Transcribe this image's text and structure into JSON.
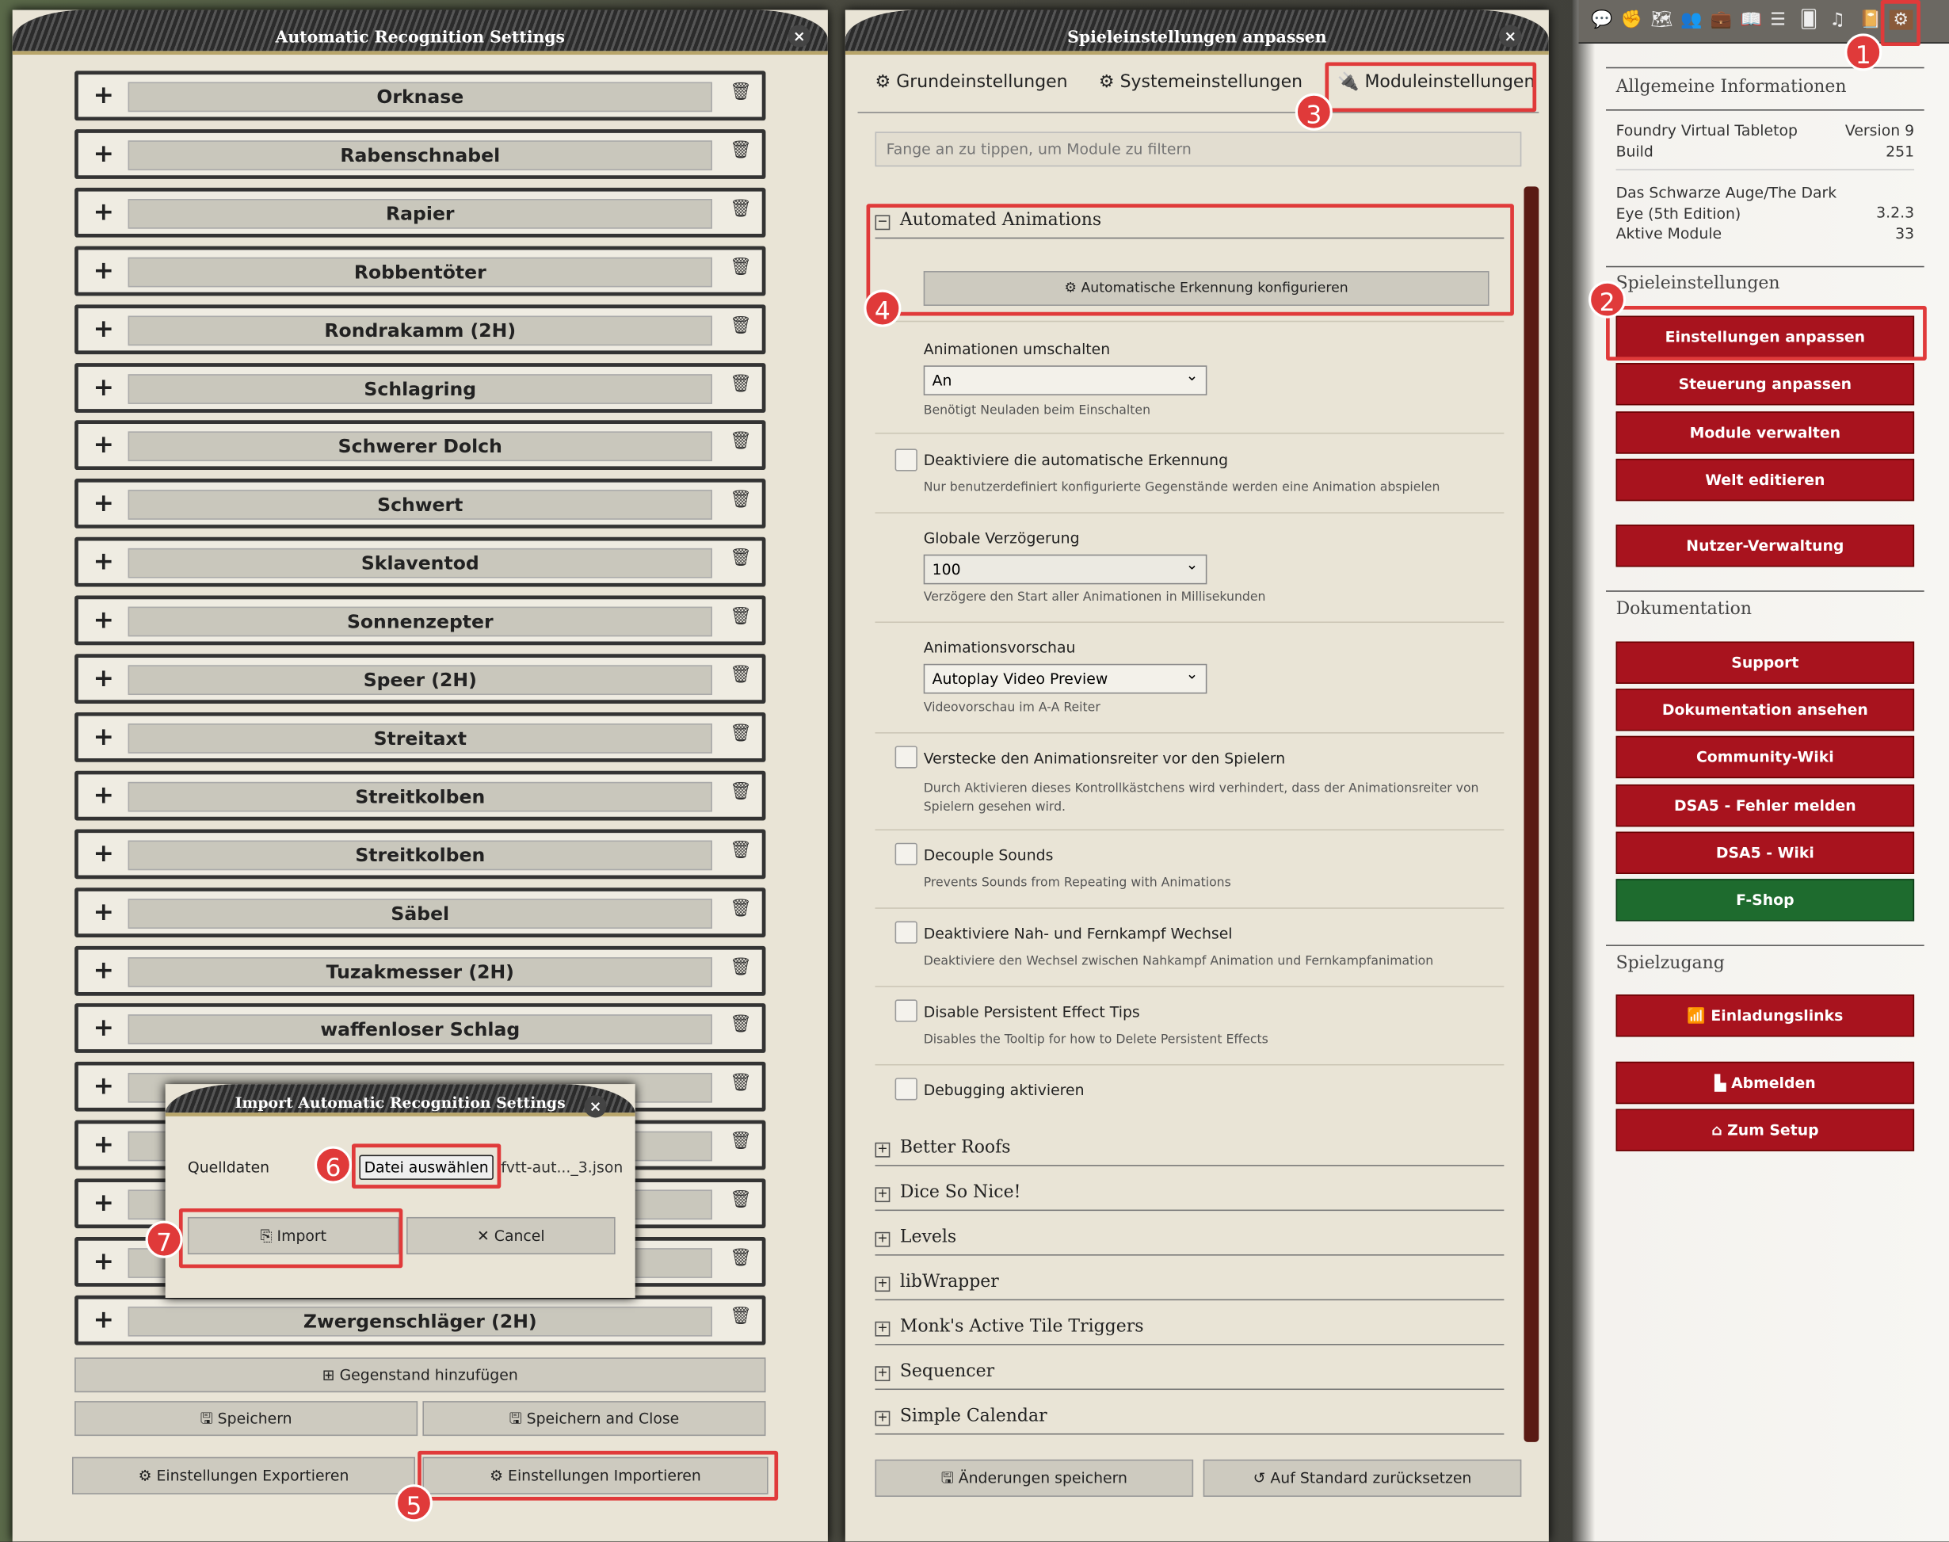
{
  "left_window": {
    "title": "Automatic Recognition Settings",
    "close_label": "×",
    "items": [
      "Orknase",
      "Rabenschnabel",
      "Rapier",
      "Robbentöter",
      "Rondrakamm (2H)",
      "Schlagring",
      "Schwerer Dolch",
      "Schwert",
      "Sklaventod",
      "Sonnenzepter",
      "Speer (2H)",
      "Streitaxt",
      "Streitkolben",
      "Streitkolben",
      "Säbel",
      "Tuzakmesser (2H)",
      "waffenloser Schlag",
      "",
      "",
      "",
      "",
      "Zwergenschläger (2H)"
    ],
    "add_item": "Gegenstand hinzufügen",
    "save": "Speichern",
    "save_close": "Speichern and Close",
    "export": "Einstellungen Exportieren",
    "import": "Einstellungen Importieren"
  },
  "import_dialog": {
    "title": "Import Automatic Recognition Settings",
    "source_label": "Quelldaten",
    "file_button": "Datei auswählen",
    "file_name": "fvtt-aut..._3.json",
    "import": "Import",
    "cancel": "Cancel"
  },
  "settings_window": {
    "title": "Spieleinstellungen anpassen",
    "tabs": [
      "Grundeinstellungen",
      "Systemeinstellungen",
      "Moduleinstellungen"
    ],
    "active_tab": "Moduleinstellungen",
    "filter_placeholder": "Fange an zu tippen, um Module zu filtern",
    "module_open": "Automated Animations",
    "config_button": "Automatische Erkennung konfigurieren",
    "anim_toggle_label": "Animationen umschalten",
    "anim_toggle_value": "An",
    "anim_toggle_hint": "Benötigt Neuladen beim Einschalten",
    "disable_auto_label": "Deaktiviere die automatische Erkennung",
    "disable_auto_hint": "Nur benutzerdefiniert konfigurierte Gegenstände werden eine Animation abspielen",
    "delay_label": "Globale Verzögerung",
    "delay_value": "100",
    "delay_hint": "Verzögere den Start aller Animationen in Millisekunden",
    "preview_label": "Animationsvorschau",
    "preview_value": "Autoplay Video Preview",
    "preview_hint": "Videovorschau im A-A Reiter",
    "hide_tab_label": "Verstecke den Animationsreiter vor den Spielern",
    "hide_tab_hint": "Durch Aktivieren dieses Kontrollkästchens wird verhindert, dass der Animationsreiter von Spielern gesehen wird.",
    "decouple_label": "Decouple Sounds",
    "decouple_hint": "Prevents Sounds from Repeating with Animations",
    "melee_label": "Deaktiviere Nah- und Fernkampf Wechsel",
    "melee_hint": "Deaktiviere den Wechsel zwischen Nahkampf Animation und Fernkampfanimation",
    "persist_label": "Disable Persistent Effect Tips",
    "persist_hint": "Disables the Tooltip for how to Delete Persistent Effects",
    "debug_label": "Debugging aktivieren",
    "modules": [
      "Better Roofs",
      "Dice So Nice!",
      "Levels",
      "libWrapper",
      "Monk's Active Tile Triggers",
      "Sequencer",
      "Simple Calendar"
    ],
    "save": "Änderungen speichern",
    "reset": "Auf Standard zurücksetzen"
  },
  "sidebar": {
    "icons": [
      "chat-icon",
      "combat-icon",
      "scenes-icon",
      "actors-icon",
      "items-icon",
      "journal-icon",
      "tables-icon",
      "cards-icon",
      "playlists-icon",
      "compendium-icon",
      "settings-icon"
    ],
    "general_heading": "Allgemeine Informationen",
    "info": [
      {
        "k": "Foundry Virtual Tabletop",
        "v": "Version 9"
      },
      {
        "k": "Build",
        "v": "251"
      }
    ],
    "system_name": "Das Schwarze Auge/The Dark Eye (5th Edition)",
    "system_version": "3.2.3",
    "modules_label": "Aktive Module",
    "modules_count": "33",
    "game_heading": "Spieleinstellungen",
    "game_buttons": [
      "Einstellungen anpassen",
      "Steuerung anpassen",
      "Module verwalten",
      "Welt editieren"
    ],
    "users_button": "Nutzer-Verwaltung",
    "doc_heading": "Dokumentation",
    "doc_buttons": [
      "Support",
      "Dokumentation ansehen",
      "Community-Wiki",
      "DSA5 - Fehler melden",
      "DSA5 - Wiki"
    ],
    "shop": "F-Shop",
    "access_heading": "Spielzugang",
    "invite": "Einladungslinks",
    "logout": "Abmelden",
    "setup": "Zum Setup"
  },
  "annotations": [
    "1",
    "2",
    "3",
    "4",
    "5",
    "6",
    "7"
  ],
  "colors": {
    "accent_red": "#a8131e",
    "annotation_red": "#e03a3a",
    "shop_green": "#1e6b2e"
  }
}
